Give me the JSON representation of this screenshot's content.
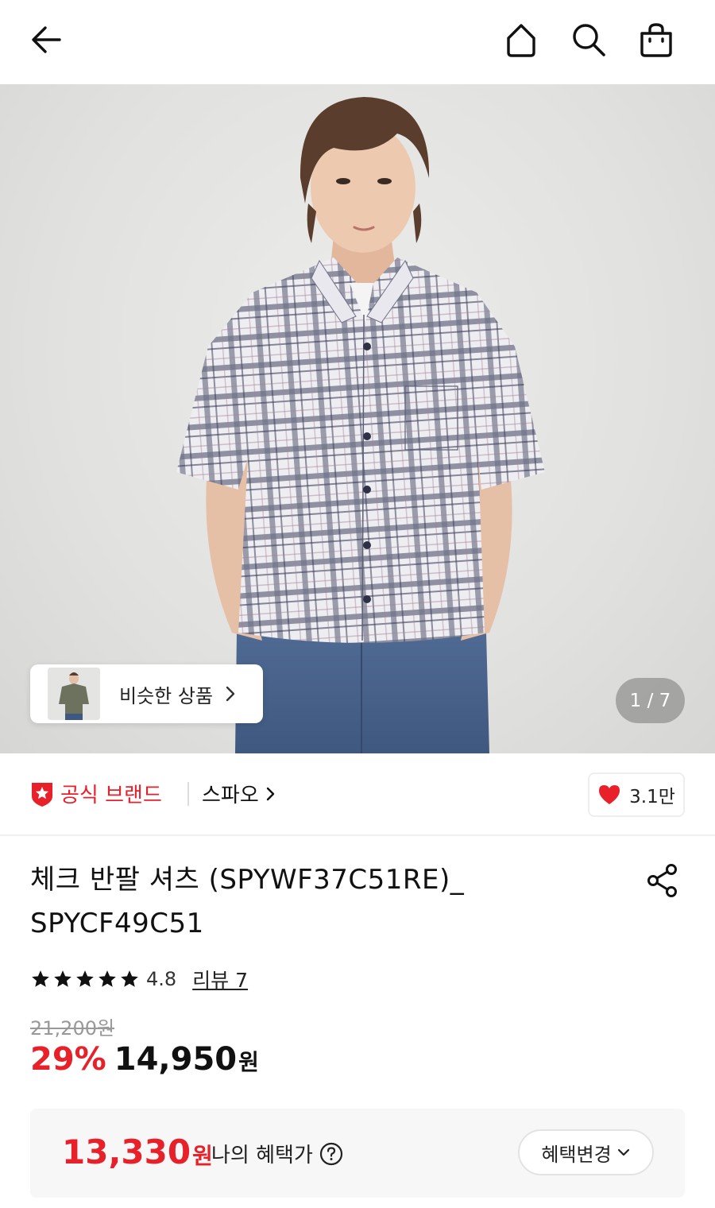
{
  "header": {
    "icons": [
      "back-arrow-icon",
      "home-icon",
      "search-icon",
      "shopping-bag-icon"
    ]
  },
  "hero": {
    "similar_label": "비슷한 상품",
    "page_indicator": "1 / 7"
  },
  "brand": {
    "official_label": "공식 브랜드",
    "brand_name": "스파오",
    "like_count": "3.1만",
    "accent_color": "#e8202a"
  },
  "product": {
    "title": "체크 반팔 셔츠 (SPYWF37C51RE)_SPYCF49C51",
    "rating": {
      "score": "4.8",
      "stars": 5,
      "review_link": "리뷰 7"
    },
    "original_price": "21,200원",
    "discount": "29%",
    "sale_price": "14,950",
    "currency": "원"
  },
  "benefit": {
    "price": "13,330",
    "currency": "원",
    "label": "나의 혜택가",
    "change_button": "혜택변경"
  }
}
